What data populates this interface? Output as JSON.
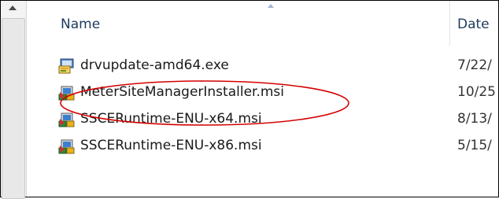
{
  "header": {
    "name_label": "Name",
    "date_label": "Date"
  },
  "files": [
    {
      "name": "drvupdate-amd64.exe",
      "date": "7/22/",
      "icon": "exe-setup-icon"
    },
    {
      "name": "MeterSiteManagerInstaller.msi",
      "date": "10/25",
      "icon": "msi-installer-icon"
    },
    {
      "name": "SSCERuntime-ENU-x64.msi",
      "date": "8/13/",
      "icon": "msi-installer-icon"
    },
    {
      "name": "SSCERuntime-ENU-x86.msi",
      "date": "5/15/",
      "icon": "msi-installer-icon"
    }
  ],
  "annotation": {
    "circle_color": "#d40000",
    "circled_file_index": 1
  }
}
